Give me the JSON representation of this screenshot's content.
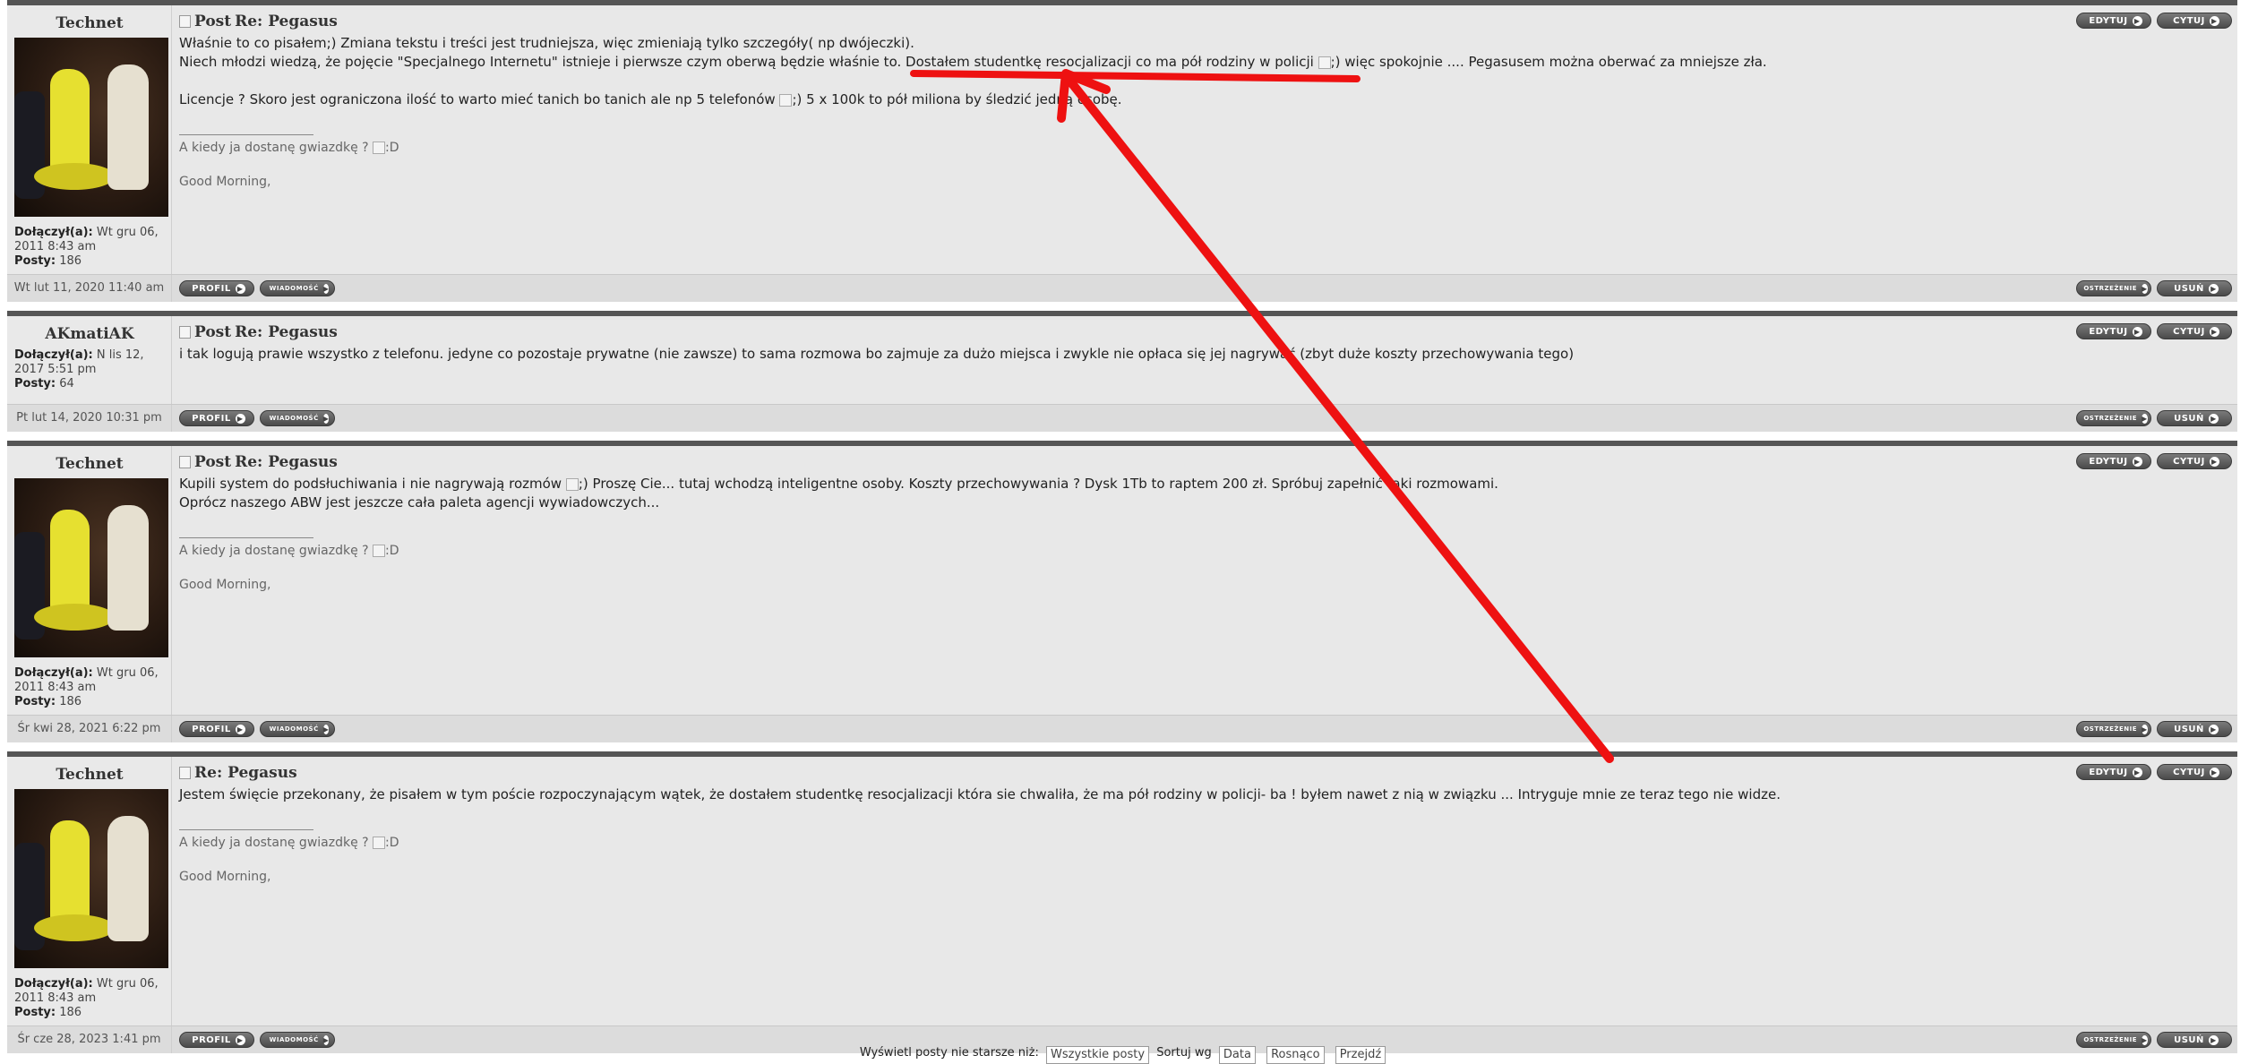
{
  "posts": [
    {
      "author": "Technet",
      "has_avatar": true,
      "joined_label": "Dołączył(a):",
      "joined_value": "Wt gru 06, 2011 8:43 am",
      "posts_label": "Posty:",
      "posts_value": "186",
      "subject_prefix": "Post",
      "subject": "Re: Pegasus",
      "lines": [
        "Właśnie to co pisałem;) Zmiana tekstu i treści jest trudniejsza, więc zmieniają tylko szczegóły( np dwójeczki).",
        "Niech młodzi wiedzą, że pojęcie \"Specjalnego Internetu\" istnieje i pierwsze czym oberwą będzie właśnie to. Dostałem studentkę resocjalizacji co ma pół rodziny w policji",
        ";) więc spokojnie .... Pegasusem można oberwać za mniejsze zła.",
        "Licencje ? Skoro jest ograniczona ilość to warto mieć tanich bo tanich ale np 5 telefonów",
        ";) 5 x 100k to pół miliona by śledzić jedną osobę."
      ],
      "signature": [
        "A kiedy ja dostanę gwiazdkę ?",
        ":D",
        "Good Morning,"
      ],
      "date": "Wt lut 11, 2020 11:40 am"
    },
    {
      "author": "AKmatiAK",
      "has_avatar": false,
      "joined_label": "Dołączył(a):",
      "joined_value": "N lis 12, 2017 5:51 pm",
      "posts_label": "Posty:",
      "posts_value": "64",
      "subject_prefix": "Post",
      "subject": "Re: Pegasus",
      "lines": [
        "i tak logują prawie wszystko z telefonu. jedyne co pozostaje prywatne (nie zawsze) to sama rozmowa bo zajmuje za dużo miejsca i zwykle nie opłaca się jej nagrywać (zbyt duże koszty przechowywania tego)"
      ],
      "date": "Pt lut 14, 2020 10:31 pm"
    },
    {
      "author": "Technet",
      "has_avatar": true,
      "joined_label": "Dołączył(a):",
      "joined_value": "Wt gru 06, 2011 8:43 am",
      "posts_label": "Posty:",
      "posts_value": "186",
      "subject_prefix": "Post",
      "subject": "Re: Pegasus",
      "lines": [
        "Kupili system do podsłuchiwania i nie nagrywają rozmów",
        ";) Proszę Cie... tutaj wchodzą inteligentne osoby. Koszty przechowywania ? Dysk 1Tb to raptem 200 zł. Spróbuj zapełnić taki rozmowami.",
        "Oprócz naszego ABW jest jeszcze cała paleta agencji wywiadowczych..."
      ],
      "signature": [
        "A kiedy ja dostanę gwiazdkę ?",
        ":D",
        "Good Morning,"
      ],
      "date": "Śr kwi 28, 2021 6:22 pm"
    },
    {
      "author": "Technet",
      "has_avatar": true,
      "joined_label": "Dołączył(a):",
      "joined_value": "Wt gru 06, 2011 8:43 am",
      "posts_label": "Posty:",
      "posts_value": "186",
      "subject_prefix": "",
      "subject": "Re: Pegasus",
      "lines": [
        "Jestem święcie przekonany, że pisałem w tym poście rozpoczynającym wątek, że dostałem studentkę resocjalizacji która sie chwaliła, że ma pół rodziny w policji- ba ! byłem nawet z nią w związku ... Intryguje mnie ze teraz tego nie widze."
      ],
      "signature": [
        "A kiedy ja dostanę gwiazdkę ?",
        ":D",
        "Good Morning,"
      ],
      "date": "Śr cze 28, 2023 1:41 pm"
    }
  ],
  "buttons": {
    "edit": "EDYTUJ",
    "quote": "CYTUJ",
    "profile": "PROFIL",
    "message": "WIADOMOŚĆ",
    "warn": "OSTRZEŻENIE",
    "delete": "USUŃ",
    "arrow_glyph": "▶"
  },
  "bottom": {
    "show_label": "Wyświetl posty nie starsze niż:",
    "show_value": "Wszystkie posty",
    "sort_label": "Sortuj wg",
    "sort_value": "Data",
    "order_value": "Rosnąco",
    "go": "Przejdź"
  },
  "annotation_color": "#ee1111"
}
